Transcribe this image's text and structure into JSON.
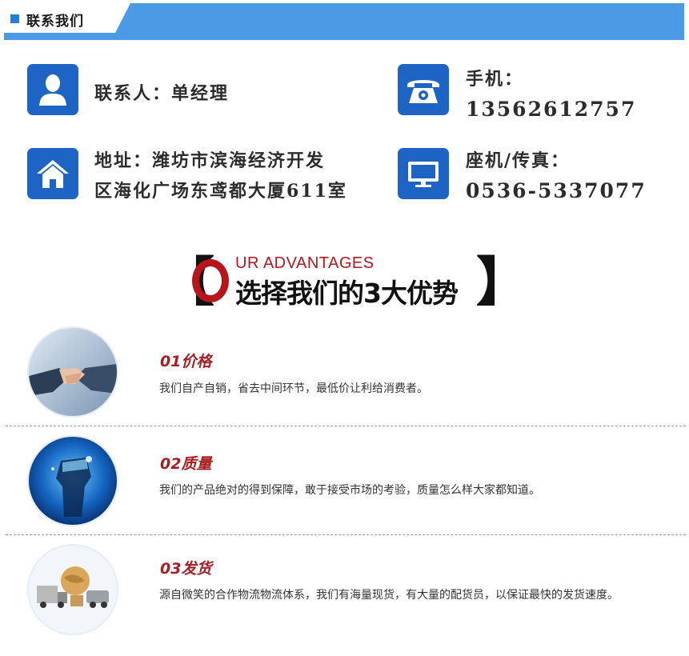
{
  "header": {
    "title": "联系我们"
  },
  "contacts": {
    "person": {
      "label": "联系人：单经理"
    },
    "phone": {
      "label": "手机：",
      "value": "13562612757"
    },
    "address": {
      "line1": "地址：潍坊市滨海经济开发",
      "line2": "区海化广场东鸢都大厦611室"
    },
    "fax": {
      "label": "座机/传真：",
      "value": "0536-5337077"
    }
  },
  "advantages_title": {
    "big_letter": "O",
    "english": "UR ADVANTAGES",
    "chinese": "选择我们的3大优势",
    "open": "【",
    "close": "】"
  },
  "advantages": [
    {
      "heading": "01价格",
      "text": "我们自产自销，省去中间环节，最低价让利给消费者。",
      "image": "handshake-image"
    },
    {
      "heading": "02质量",
      "text": "我们的产品绝对的得到保障，敢于接受市场的考验，质量怎么样大家都知道。",
      "image": "fist-image"
    },
    {
      "heading": "03发货",
      "text": "源自微笑的合作物流物流体系，我们有海量现货，有大量的配货员，以保证最快的发货速度。",
      "image": "logistics-image"
    }
  ],
  "colors": {
    "header_blue": "#4a9ae6",
    "icon_blue": "#1d64c4",
    "accent_red": "#a81e22"
  }
}
